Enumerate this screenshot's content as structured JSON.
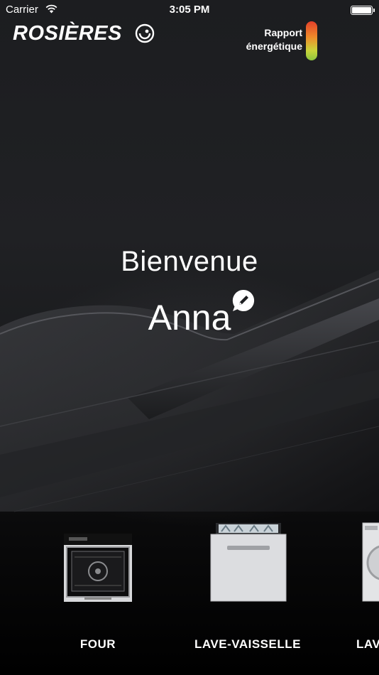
{
  "status_bar": {
    "carrier": "Carrier",
    "time": "3:05 PM"
  },
  "header": {
    "brand": "ROSIÈRES",
    "energy_report_line1": "Rapport",
    "energy_report_line2": "énergétique"
  },
  "welcome": {
    "greeting": "Bienvenue",
    "user_name": "Anna"
  },
  "appliances": [
    {
      "label": "FOUR",
      "icon": "oven-icon"
    },
    {
      "label": "LAVE-VAISSELLE",
      "icon": "dishwasher-icon"
    },
    {
      "label": "LAV",
      "icon": "washing-machine-icon"
    }
  ],
  "colors": {
    "energy_high": "#e2402a",
    "energy_mid": "#ee8a2a",
    "energy_low": "#8cc63f",
    "background": "#1c1d20"
  }
}
